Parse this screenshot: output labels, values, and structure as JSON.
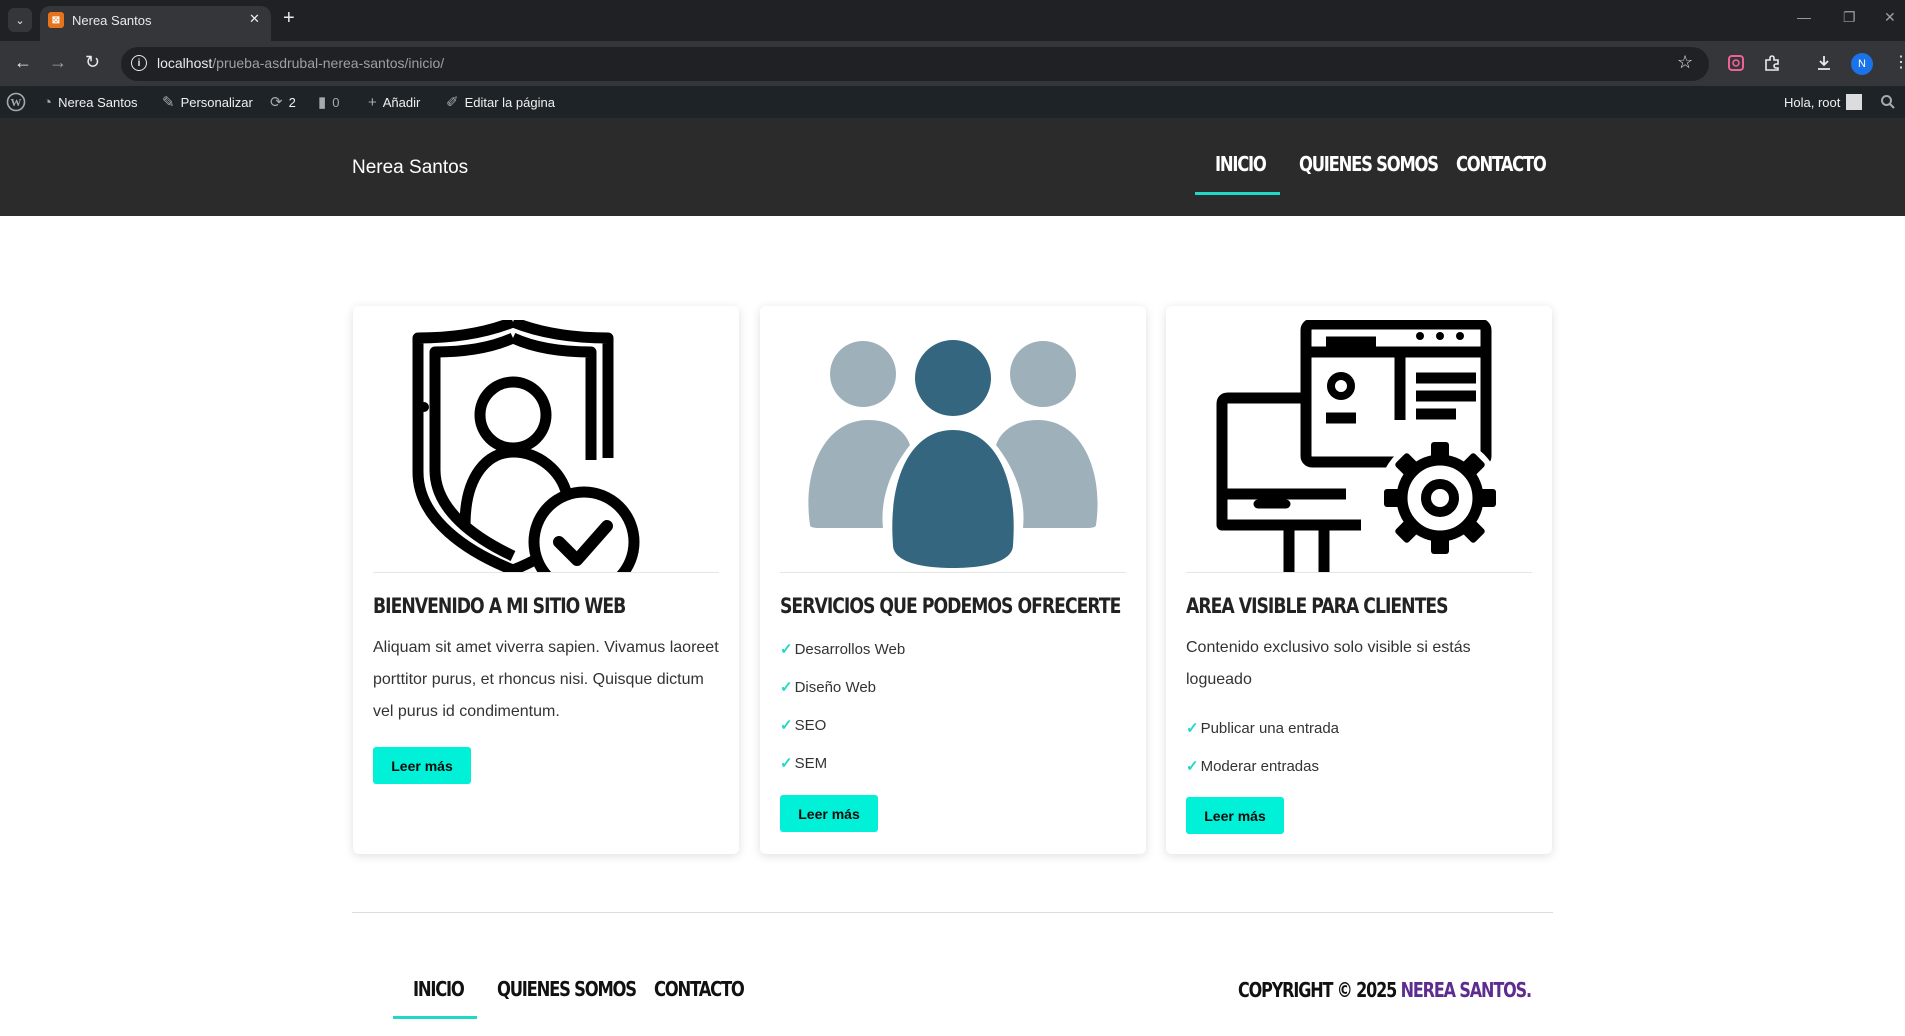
{
  "browser": {
    "tab_title": "Nerea Santos",
    "url_host": "localhost",
    "url_path": "/prueba-asdrubal-nerea-santos/inicio/",
    "profile_initial": "N",
    "colors": {
      "frame": "#202124",
      "toolbar": "#35363a"
    }
  },
  "adminbar": {
    "site_name": "Nerea Santos",
    "customize": "Personalizar",
    "updates_count": "2",
    "comments_count": "0",
    "add_new": "Añadir",
    "edit_page": "Editar la página",
    "greeting": "Hola, root"
  },
  "header": {
    "site_title": "Nerea Santos",
    "nav": [
      "INICIO",
      "QUIENES SOMOS",
      "CONTACTO"
    ],
    "active_nav": "INICIO"
  },
  "cards": [
    {
      "icon": "shield-user-check-icon",
      "title": "BIENVENIDO A MI SITIO WEB",
      "text": "Aliquam sit amet viverra sapien. Vivamus laoreet porttitor purus, et rhoncus nisi. Quisque dictum vel purus id condimentum.",
      "button": "Leer más"
    },
    {
      "icon": "team-people-icon",
      "title": "SERVICIOS QUE PODEMOS OFRECERTE",
      "list": [
        "Desarrollos Web",
        "Diseño Web",
        "SEO",
        "SEM"
      ],
      "button": "Leer más"
    },
    {
      "icon": "monitor-settings-icon",
      "title": "AREA VISIBLE PARA CLIENTES",
      "text": "Contenido exclusivo solo visible si estás logueado",
      "list": [
        "Publicar una entrada",
        "Moderar entradas"
      ],
      "button": "Leer más"
    }
  ],
  "footer": {
    "nav": [
      "INICIO",
      "QUIENES SOMOS",
      "CONTACTO"
    ],
    "active_nav": "INICIO",
    "copyright_prefix": "COPYRIGHT © 2025",
    "copyright_name": "NEREA SANTOS."
  },
  "colors": {
    "accent": "#00f0d8",
    "underline": "#1fd8c6",
    "header_bg": "#2b2b2b",
    "brand_purple": "#5d2c8e"
  }
}
